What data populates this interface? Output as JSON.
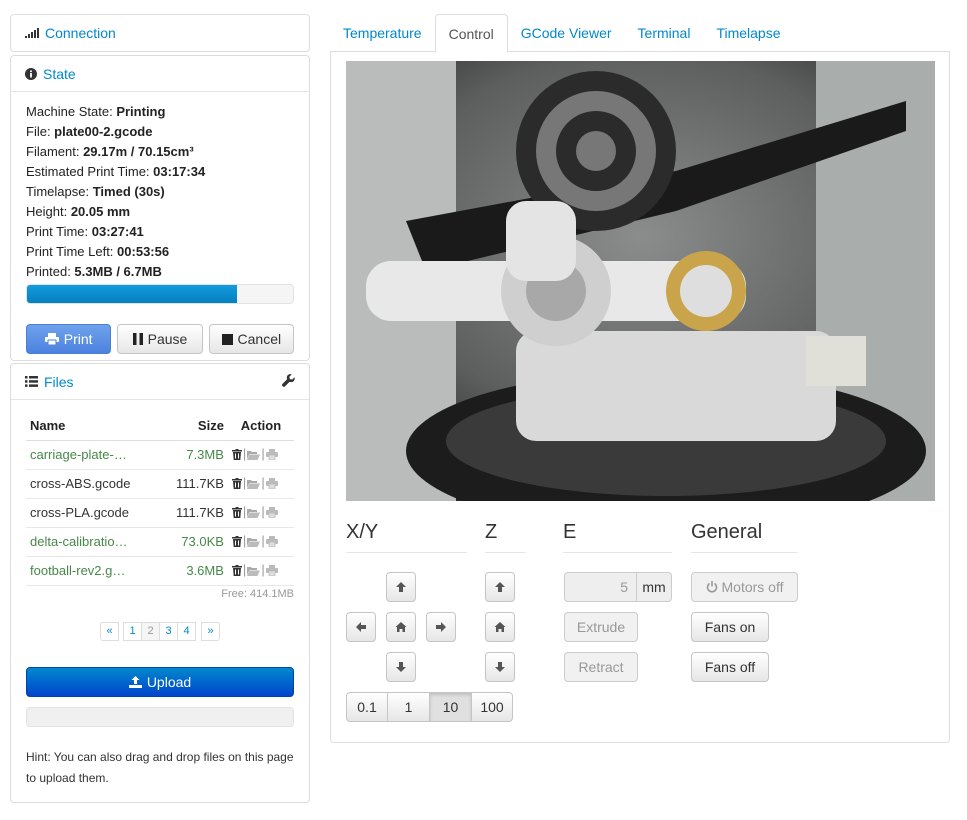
{
  "connection": {
    "title": "Connection",
    "icon": "signal-icon"
  },
  "state": {
    "title": "State",
    "icon": "info-icon",
    "rows": [
      {
        "label": "Machine State: ",
        "value": "Printing"
      },
      {
        "label": "File: ",
        "value": "plate00-2.gcode"
      },
      {
        "label": "Filament: ",
        "value": "29.17m / 70.15cm³"
      },
      {
        "label": "Estimated Print Time: ",
        "value": "03:17:34"
      },
      {
        "label": "Timelapse: ",
        "value": "Timed (30s)"
      },
      {
        "label": "Height: ",
        "value": "20.05 mm"
      },
      {
        "label": "Print Time: ",
        "value": "03:27:41"
      },
      {
        "label": "Print Time Left: ",
        "value": "00:53:56"
      },
      {
        "label": "Printed: ",
        "value": "5.3MB / 6.7MB"
      }
    ],
    "progress_fraction": 0.79,
    "buttons": {
      "print": "Print",
      "pause": "Pause",
      "cancel": "Cancel"
    }
  },
  "files": {
    "title": "Files",
    "icon": "list-icon",
    "settings_icon": "wrench-icon",
    "columns": {
      "name": "Name",
      "size": "Size",
      "action": "Action"
    },
    "rows": [
      {
        "name": "carriage-plate-…",
        "size": "7.3MB",
        "highlight": true
      },
      {
        "name": "cross-ABS.gcode",
        "size": "111.7KB",
        "highlight": false
      },
      {
        "name": "cross-PLA.gcode",
        "size": "111.7KB",
        "highlight": false
      },
      {
        "name": "delta-calibratio…",
        "size": "73.0KB",
        "highlight": true
      },
      {
        "name": "football-rev2.g…",
        "size": "3.6MB",
        "highlight": true
      }
    ],
    "free": "Free: 414.1MB",
    "pagination": {
      "first": "«",
      "pages": [
        "1",
        "2",
        "3",
        "4"
      ],
      "active": "2",
      "last": "»"
    },
    "upload_label": "Upload",
    "hint": "Hint: You can also drag and drop files on this page to upload them."
  },
  "tabs": [
    {
      "label": "Temperature",
      "active": false
    },
    {
      "label": "Control",
      "active": true
    },
    {
      "label": "GCode Viewer",
      "active": false
    },
    {
      "label": "Terminal",
      "active": false
    },
    {
      "label": "Timelapse",
      "active": false
    }
  ],
  "control": {
    "headers": {
      "xy": "X/Y",
      "z": "Z",
      "e": "E",
      "general": "General"
    },
    "steps": [
      "0.1",
      "1",
      "10",
      "100"
    ],
    "active_step": "10",
    "extrude_amount": "5",
    "extrude_unit": "mm",
    "extrude_label": "Extrude",
    "retract_label": "Retract",
    "motors_off_label": "Motors off",
    "fans_on_label": "Fans on",
    "fans_off_label": "Fans off"
  }
}
